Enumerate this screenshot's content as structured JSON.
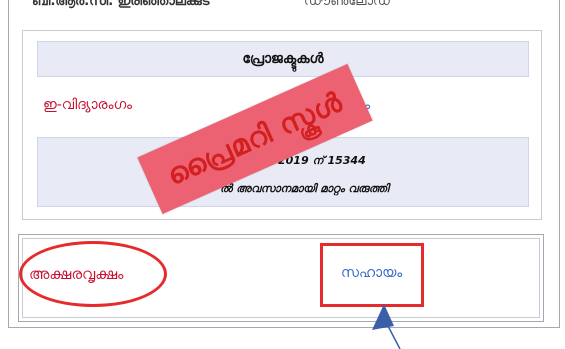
{
  "top_row": {
    "label": "ബി.ആർ.സി. ഇരിഞ്ഞാലക്കുട",
    "value": "ഡൗൺലോഡ്"
  },
  "projects": {
    "header": "പ്രോജക്ടുകൾ",
    "row_name": "ഇ-വിദ്യാരംഗം",
    "row_trail": "ം"
  },
  "news": {
    "line_1": "2019 ന് 15344",
    "line_2": "ൽ അവസാനമായി മാറ്റം വരുത്തി"
  },
  "stamp": {
    "text": "പ്രൈമറി സ്കൂൾ",
    "color": "#ec6272"
  },
  "footer": {
    "left_link": "അക്ഷരവൃക്ഷം",
    "right_link": "സഹായം"
  },
  "colors": {
    "link_red": "#c8102e",
    "link_blue": "#3366cc",
    "highlight_red": "#e52b2b",
    "panel_bg": "#e8eaf6",
    "arrow": "#3a5fa8"
  }
}
